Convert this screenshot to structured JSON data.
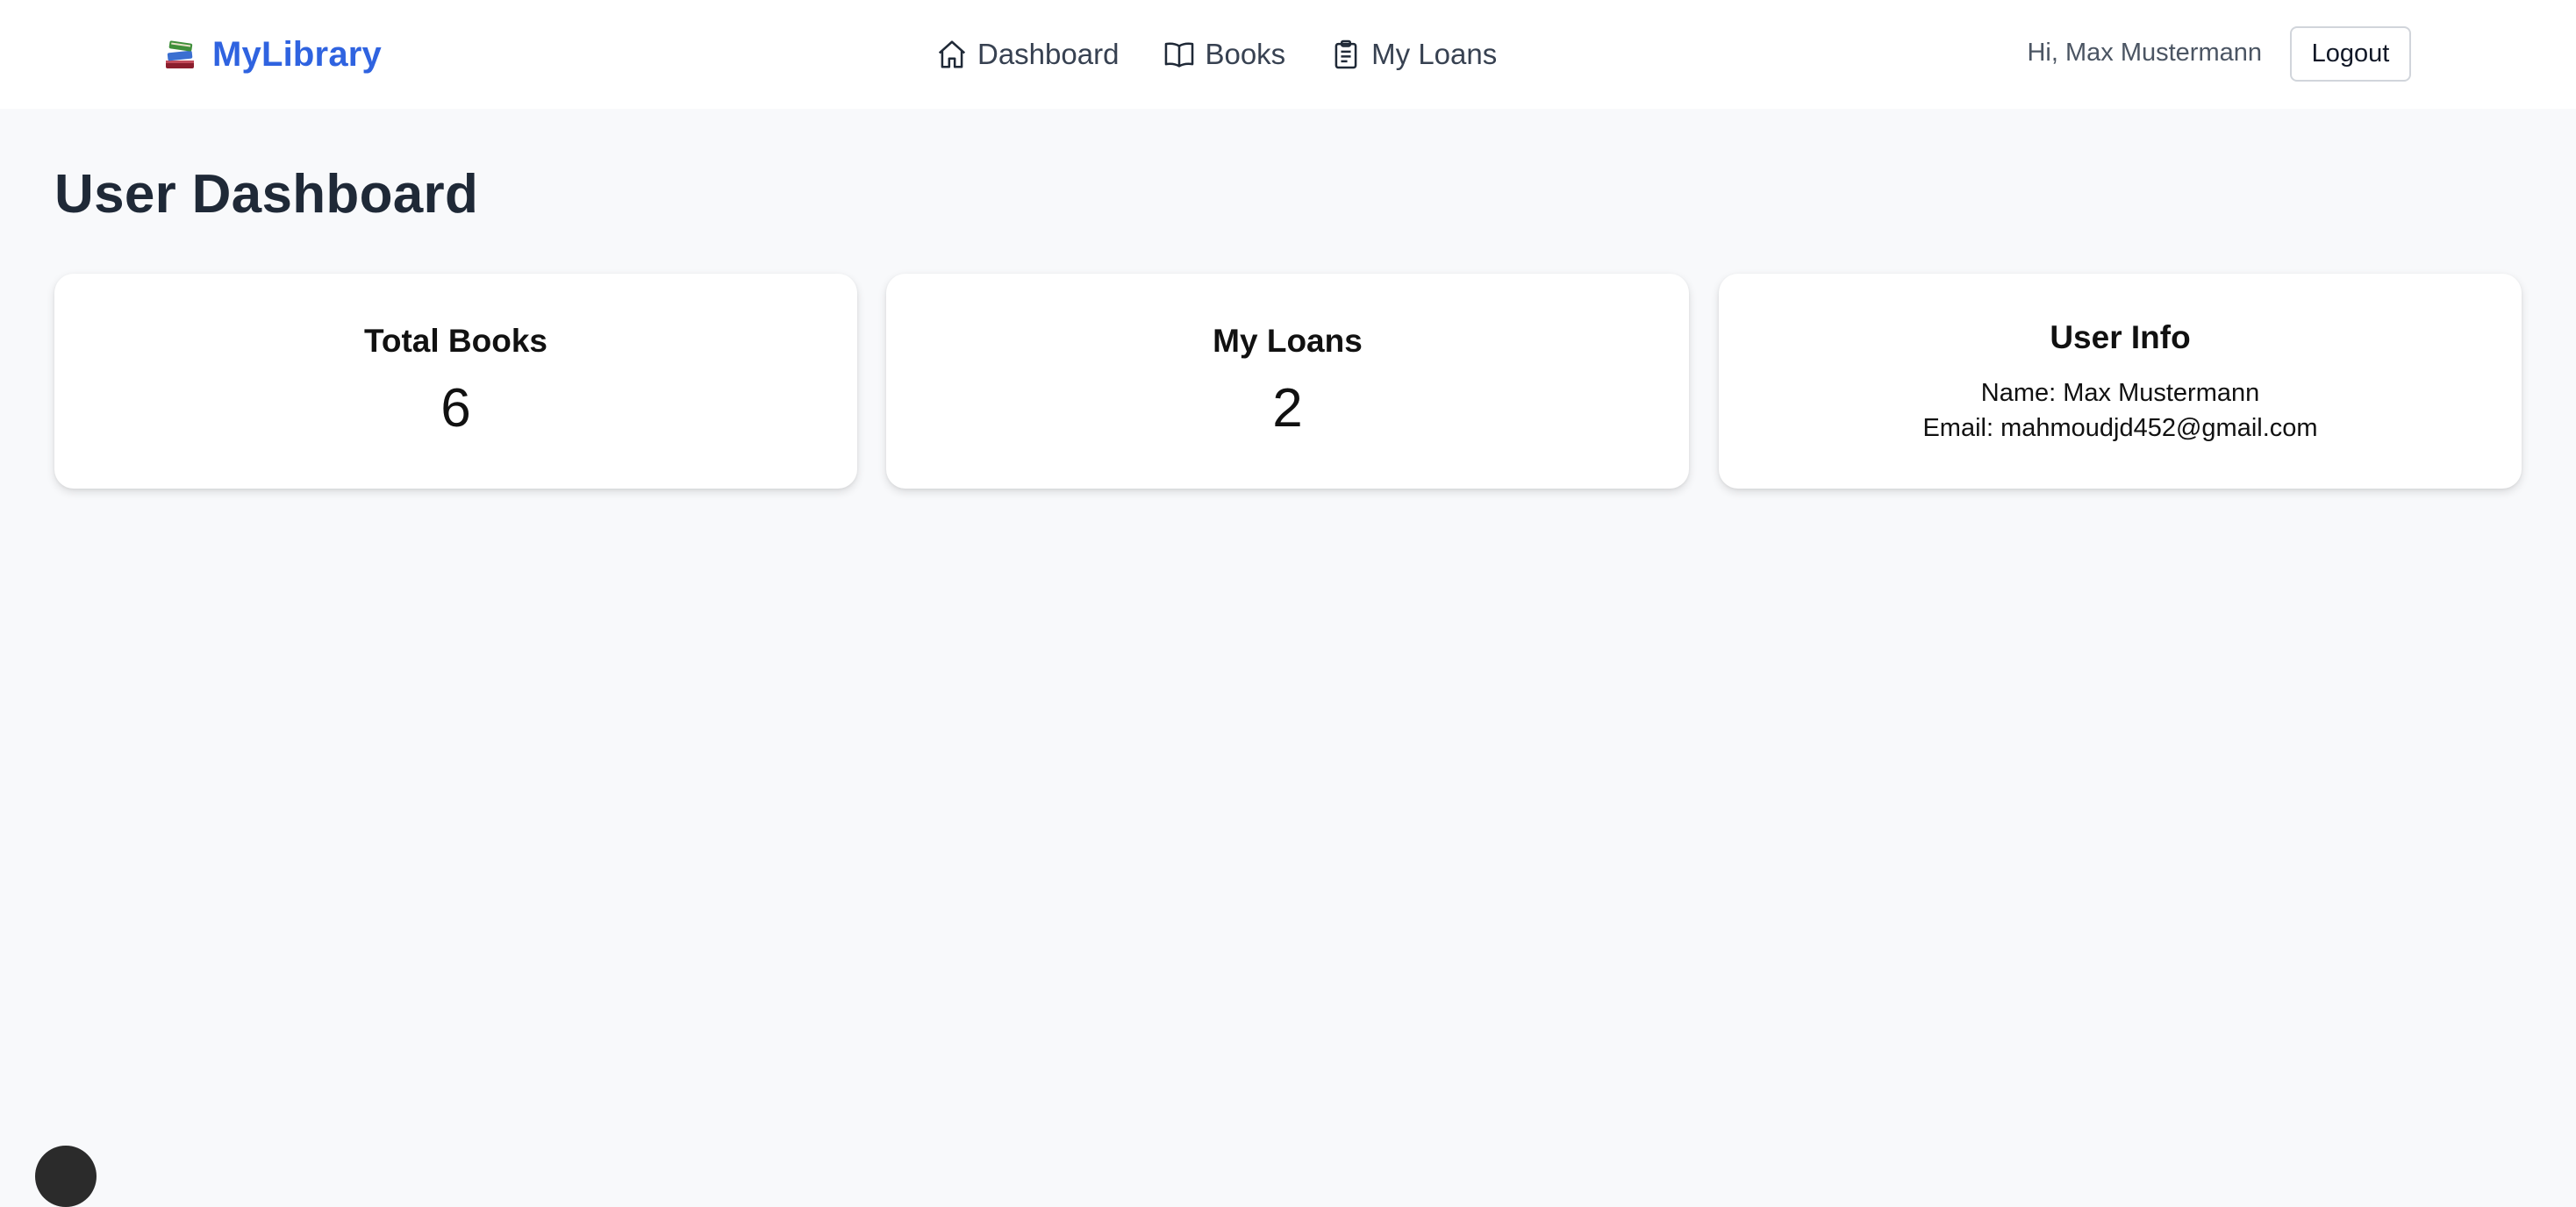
{
  "header": {
    "brand_name": "MyLibrary",
    "brand_icon": "books-stack-icon",
    "nav": [
      {
        "label": "Dashboard",
        "icon": "home-icon"
      },
      {
        "label": "Books",
        "icon": "open-book-icon"
      },
      {
        "label": "My Loans",
        "icon": "clipboard-icon"
      }
    ],
    "greeting": "Hi, Max Mustermann",
    "logout_label": "Logout"
  },
  "main": {
    "title": "User Dashboard",
    "cards": {
      "total_books": {
        "title": "Total Books",
        "value": "6"
      },
      "my_loans": {
        "title": "My Loans",
        "value": "2"
      },
      "user_info": {
        "title": "User Info",
        "name": "Name: Max Mustermann",
        "email": "Email: mahmoudjd452@gmail.com"
      }
    }
  },
  "colors": {
    "brand": "#2f63e0",
    "page_background": "#f8f9fb",
    "card_background": "#ffffff",
    "text": "#1f2937"
  }
}
